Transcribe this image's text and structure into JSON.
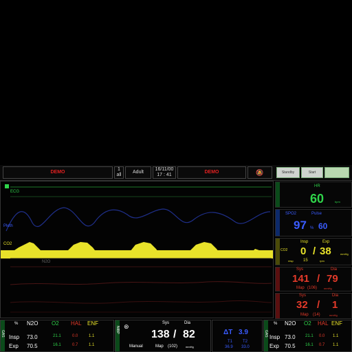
{
  "topbar": {
    "demo_left": "DEMO",
    "field_1": "1",
    "field_1b": "all",
    "patient_type": "Adult",
    "date": "16/11/00",
    "time": "17 : 41",
    "demo_right": "DEMO",
    "btn_1": "Standby",
    "btn_2": "Start",
    "btn_3": ""
  },
  "waves": {
    "ecg_label": "ECG",
    "pleth_label": "Pleth",
    "co2_label": "CO2",
    "aux_label": "N2O"
  },
  "hr": {
    "label": "HR",
    "value": "60",
    "unit": "bpm"
  },
  "spo2": {
    "label": "SPO2",
    "pulse_label": "Pulse",
    "value": "97",
    "unit": "%",
    "pulse_value": "60"
  },
  "co2": {
    "side_label": "CO2",
    "insp_label": "Insp",
    "exp_label": "Exp",
    "insp_value": "0",
    "exp_value": "38",
    "unit": "mmHg",
    "resp_label": "resp",
    "resp_value": "15",
    "resp_unit": "rpm"
  },
  "abp": {
    "sys_label": "Sys",
    "dia_label": "Dia",
    "sys": "141",
    "dia": "79",
    "map_label": "Map",
    "map": "(106)",
    "unit": "mmHg"
  },
  "pap": {
    "sys_label": "Sys",
    "dia_label": "Dia",
    "sys": "32",
    "dia": "1",
    "map_label": "Map",
    "map": "(14)",
    "unit": "mmHg"
  },
  "gas_left": {
    "side_label": "GAS",
    "pct": "%",
    "col_n2o": "N2O",
    "col_o2": "O2",
    "col_hal": "HAL",
    "col_enf": "ENF",
    "insp_label": "Insp",
    "exp_label": "Exp",
    "insp": [
      "73.0",
      "21.1",
      "0.0",
      "1.1"
    ],
    "exp": [
      "70.5",
      "16.1",
      "0.7",
      "1.1"
    ]
  },
  "nibp": {
    "side_label": "NIBP",
    "sys_label": "Sys",
    "dia_label": "Dia",
    "sys": "138",
    "dia": "82",
    "mode": "Manual",
    "map_label": "Map",
    "map": "(102)",
    "unit": "mmHg"
  },
  "temp": {
    "delta_label": "ΔT",
    "delta_value": "3.9",
    "t1_label": "T1",
    "t2_label": "T2",
    "t1": "36.9",
    "t2": "33.0"
  },
  "gas_right": {
    "side_label": "GAS",
    "pct": "%",
    "col_n2o": "N2O",
    "col_o2": "O2",
    "col_hal": "HAL",
    "col_enf": "ENF",
    "insp_label": "Insp",
    "exp_label": "Exp",
    "insp": [
      "73.0",
      "21.1",
      "0.0",
      "1.1"
    ],
    "exp": [
      "70.5",
      "16.1",
      "0.7",
      "1.1"
    ]
  },
  "colors": {
    "hr": "#2fd44a",
    "spo2": "#3a5cff",
    "co2": "#e8e22a",
    "pressure": "#e43a2a",
    "demo": "#e02020"
  }
}
